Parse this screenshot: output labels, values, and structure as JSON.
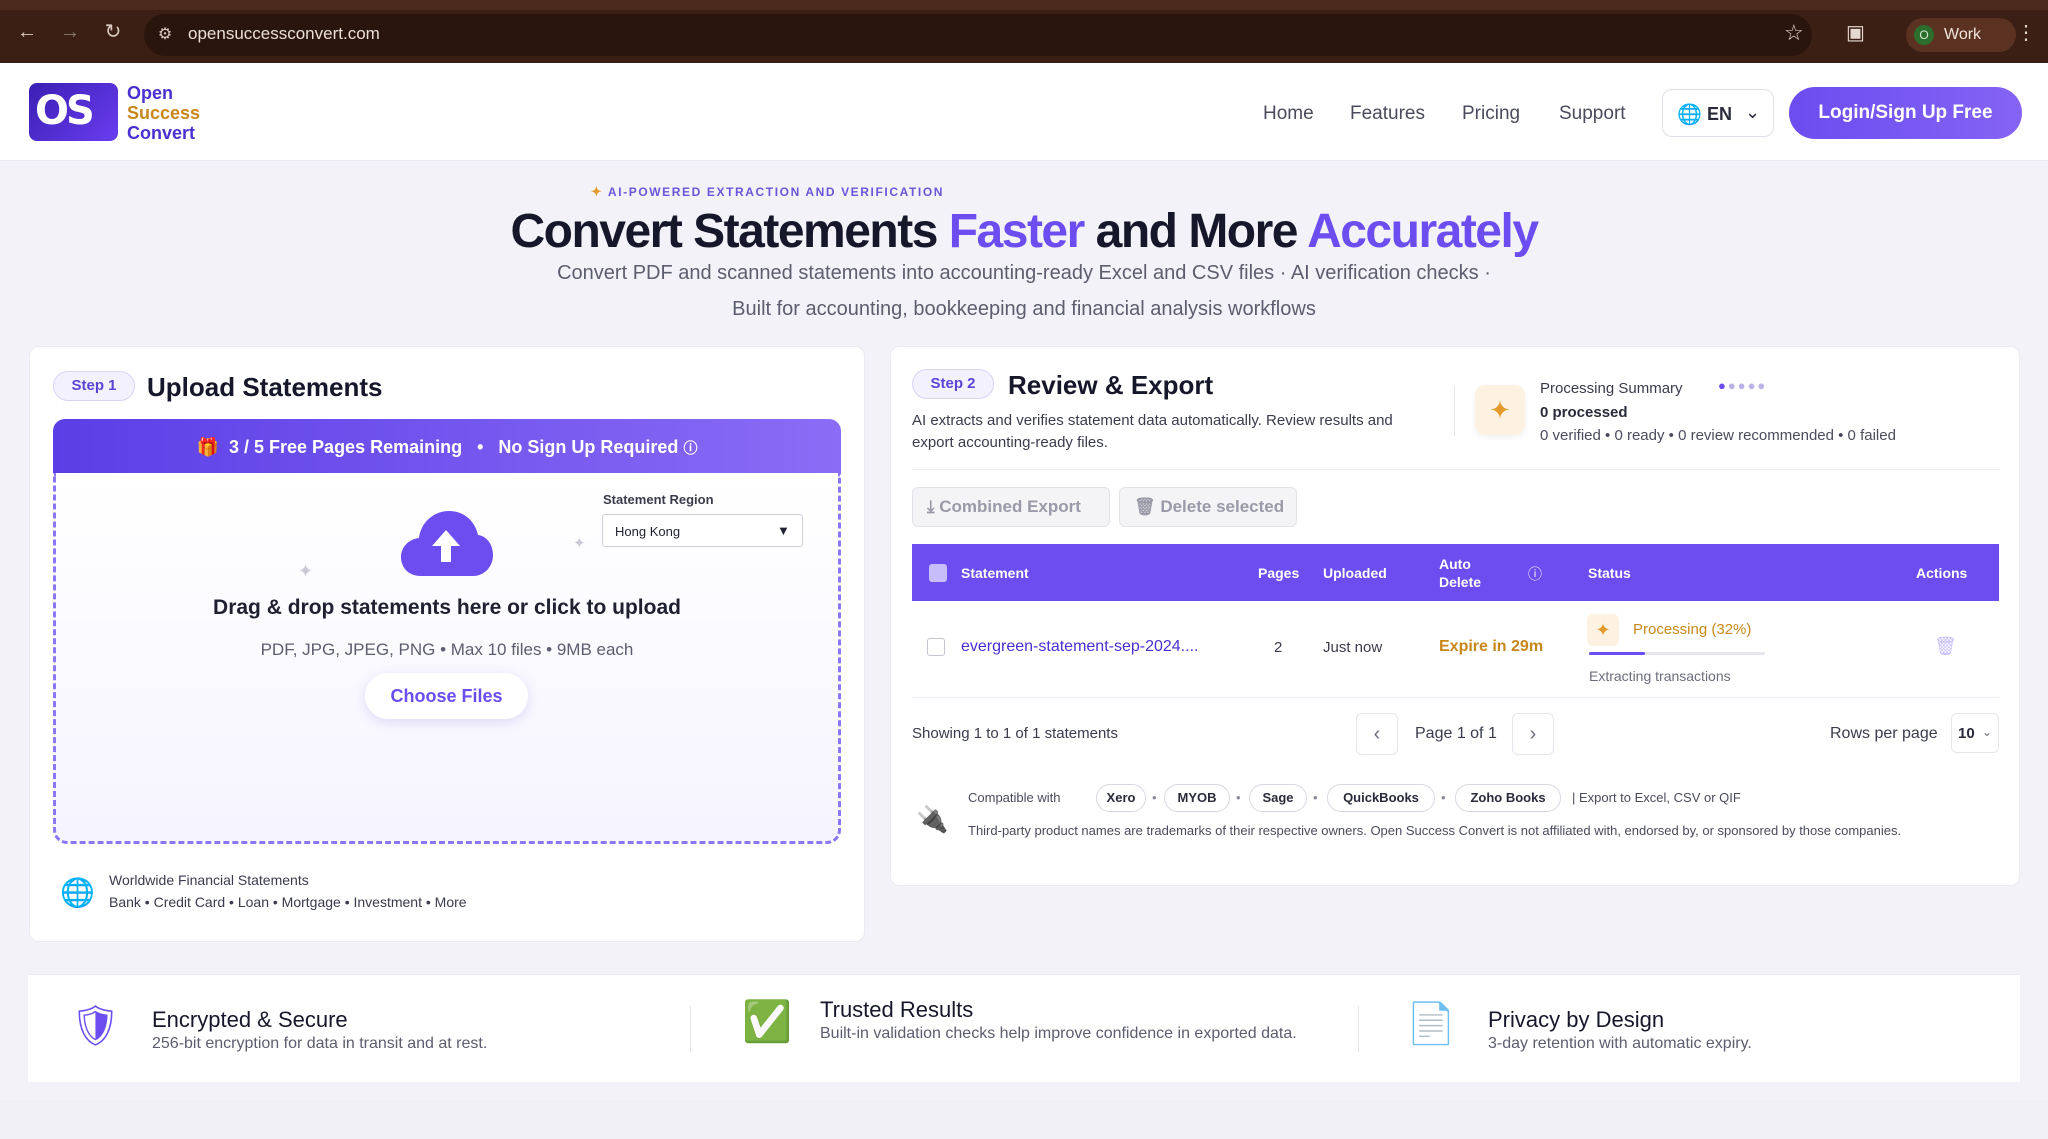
{
  "browser": {
    "url": "opensuccessconvert.com",
    "profile_initial": "O",
    "profile_name": "Work"
  },
  "brand": {
    "logo_mark": "OS",
    "line1": "Open",
    "line2": "Success",
    "line3": "Convert"
  },
  "nav": {
    "items": [
      "Home",
      "Features",
      "Pricing",
      "Support"
    ],
    "language": "EN",
    "login_label": "Login/Sign Up Free"
  },
  "hero": {
    "tag": "AI-POWERED EXTRACTION AND VERIFICATION",
    "title_part1": "Convert Statements ",
    "title_accent1": "Faster",
    "title_part2": " and More ",
    "title_accent2": "Accurately",
    "subtitle1": "Convert PDF and scanned statements into accounting-ready Excel and CSV files  ·  AI verification checks  ·",
    "subtitle2": "Built for accounting, bookkeeping and financial analysis workflows"
  },
  "upload": {
    "step": "Step 1",
    "title": "Upload Statements",
    "banner_pages": "3 / 5 Free Pages Remaining",
    "banner_nosignup": "No Sign Up Required",
    "region_label": "Statement Region",
    "region_value": "Hong Kong",
    "drag_text": "Drag & drop statements here or click to upload",
    "formats": "PDF, JPG, JPEG, PNG • Max 10 files • 9MB each",
    "choose_label": "Choose Files",
    "worldwide_title": "Worldwide Financial Statements",
    "worldwide_types": "Bank • Credit Card • Loan • Mortgage • Investment • More"
  },
  "review": {
    "step": "Step 2",
    "title": "Review & Export",
    "description": "AI extracts and verifies statement data automatically. Review results and export accounting-ready files.",
    "summary_title": "Processing Summary",
    "summary_count": "0 processed",
    "summary_details": "0 verified • 0 ready • 0 review recommended • 0 failed",
    "combined_export": "Combined Export",
    "delete_selected": "Delete selected",
    "columns": {
      "statement": "Statement",
      "pages": "Pages",
      "uploaded": "Uploaded",
      "auto_delete_1": "Auto",
      "auto_delete_2": "Delete",
      "status": "Status",
      "actions": "Actions"
    },
    "rows": [
      {
        "file": "evergreen-statement-sep-2024....",
        "pages": "2",
        "uploaded": "Just now",
        "auto_delete": "Expire in 29m",
        "status": "Processing (32%)",
        "progress": 0.32,
        "status_detail": "Extracting transactions"
      }
    ],
    "showing": "Showing 1 to 1 of 1 statements",
    "page_label": "Page 1 of 1",
    "rows_per_page_label": "Rows per page",
    "rows_per_page": "10",
    "compatible_label": "Compatible with",
    "compatible": [
      "Xero",
      "MYOB",
      "Sage",
      "QuickBooks",
      "Zoho Books"
    ],
    "export_note": "| Export to Excel, CSV or QIF",
    "disclaimer": "Third-party product names are trademarks of their respective owners. Open Success Convert is not affiliated with, endorsed by, or sponsored by those companies."
  },
  "features": [
    {
      "title": "Encrypted & Secure",
      "desc": "256-bit encryption for data in transit and at rest."
    },
    {
      "title": "Trusted Results",
      "desc": "Built-in validation checks help improve confidence in exported data."
    },
    {
      "title": "Privacy by Design",
      "desc": "3-day retention with automatic expiry."
    }
  ],
  "colors": {
    "accent": "#6b4df0",
    "gold": "#c9871b",
    "brand_dark": "#4b2fd0"
  },
  "icons": [
    "back-arrow-icon",
    "forward-arrow-icon",
    "reload-icon",
    "site-info-icon",
    "star-icon",
    "extensions-icon",
    "kebab-menu-icon",
    "globe-icon",
    "chevron-down-icon",
    "gift-icon",
    "info-icon",
    "cloud-upload-icon",
    "sparkle-icon",
    "download-icon",
    "trash-icon",
    "help-icon",
    "plug-icon",
    "shield-lock-icon",
    "check-badge-icon",
    "document-user-icon"
  ]
}
